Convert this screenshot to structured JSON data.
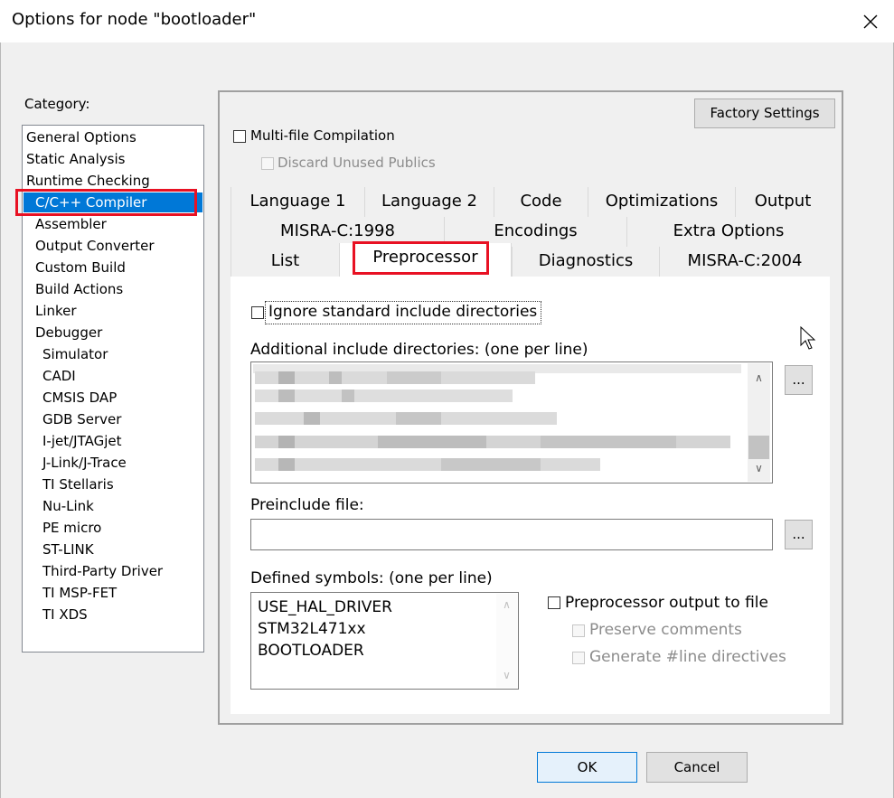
{
  "window": {
    "title": "Options for node \"bootloader\"",
    "close_icon": "close-icon"
  },
  "category": {
    "label": "Category:",
    "items": [
      {
        "label": "General Options",
        "level": 0
      },
      {
        "label": "Static Analysis",
        "level": 0
      },
      {
        "label": "Runtime Checking",
        "level": 0
      },
      {
        "label": "C/C++ Compiler",
        "level": 1,
        "selected": true
      },
      {
        "label": "Assembler",
        "level": 1
      },
      {
        "label": "Output Converter",
        "level": 1
      },
      {
        "label": "Custom Build",
        "level": 1
      },
      {
        "label": "Build Actions",
        "level": 1
      },
      {
        "label": "Linker",
        "level": 1
      },
      {
        "label": "Debugger",
        "level": 1
      },
      {
        "label": "Simulator",
        "level": 2
      },
      {
        "label": "CADI",
        "level": 2
      },
      {
        "label": "CMSIS DAP",
        "level": 2
      },
      {
        "label": "GDB Server",
        "level": 2
      },
      {
        "label": "I-jet/JTAGjet",
        "level": 2
      },
      {
        "label": "J-Link/J-Trace",
        "level": 2
      },
      {
        "label": "TI Stellaris",
        "level": 2
      },
      {
        "label": "Nu-Link",
        "level": 2
      },
      {
        "label": "PE micro",
        "level": 2
      },
      {
        "label": "ST-LINK",
        "level": 2
      },
      {
        "label": "Third-Party Driver",
        "level": 2
      },
      {
        "label": "TI MSP-FET",
        "level": 2
      },
      {
        "label": "TI XDS",
        "level": 2
      }
    ]
  },
  "options": {
    "factory_settings": "Factory Settings",
    "multi_file": {
      "label": "Multi-file Compilation",
      "checked": false
    },
    "discard_unused": {
      "label": "Discard Unused Publics",
      "checked": false,
      "disabled": true
    }
  },
  "tabs": {
    "row1": [
      "Language 1",
      "Language 2",
      "Code",
      "Optimizations",
      "Output"
    ],
    "row2": [
      "MISRA-C:1998",
      "Encodings",
      "Extra Options"
    ],
    "row3": [
      "List",
      "Preprocessor",
      "Diagnostics",
      "MISRA-C:2004"
    ],
    "active": "Preprocessor"
  },
  "preprocessor": {
    "ignore_std": {
      "label": "Ignore standard include directories",
      "checked": false
    },
    "include_dirs_label": "Additional include directories: (one per line)",
    "include_dirs_browse": "...",
    "preinclude_label": "Preinclude file:",
    "preinclude_value": "",
    "preinclude_browse": "...",
    "defined_label": "Defined symbols: (one per line)",
    "defined_symbols": [
      "USE_HAL_DRIVER",
      "STM32L471xx",
      "BOOTLOADER"
    ],
    "pp_output": {
      "label": "Preprocessor output to file",
      "checked": false
    },
    "preserve_comments": {
      "label": "Preserve comments",
      "checked": false,
      "disabled": true
    },
    "generate_line": {
      "label": "Generate #line directives",
      "checked": false,
      "disabled": true
    }
  },
  "footer": {
    "ok": "OK",
    "cancel": "Cancel"
  },
  "colors": {
    "selection": "#0078d7",
    "highlight_box": "#e81123"
  }
}
